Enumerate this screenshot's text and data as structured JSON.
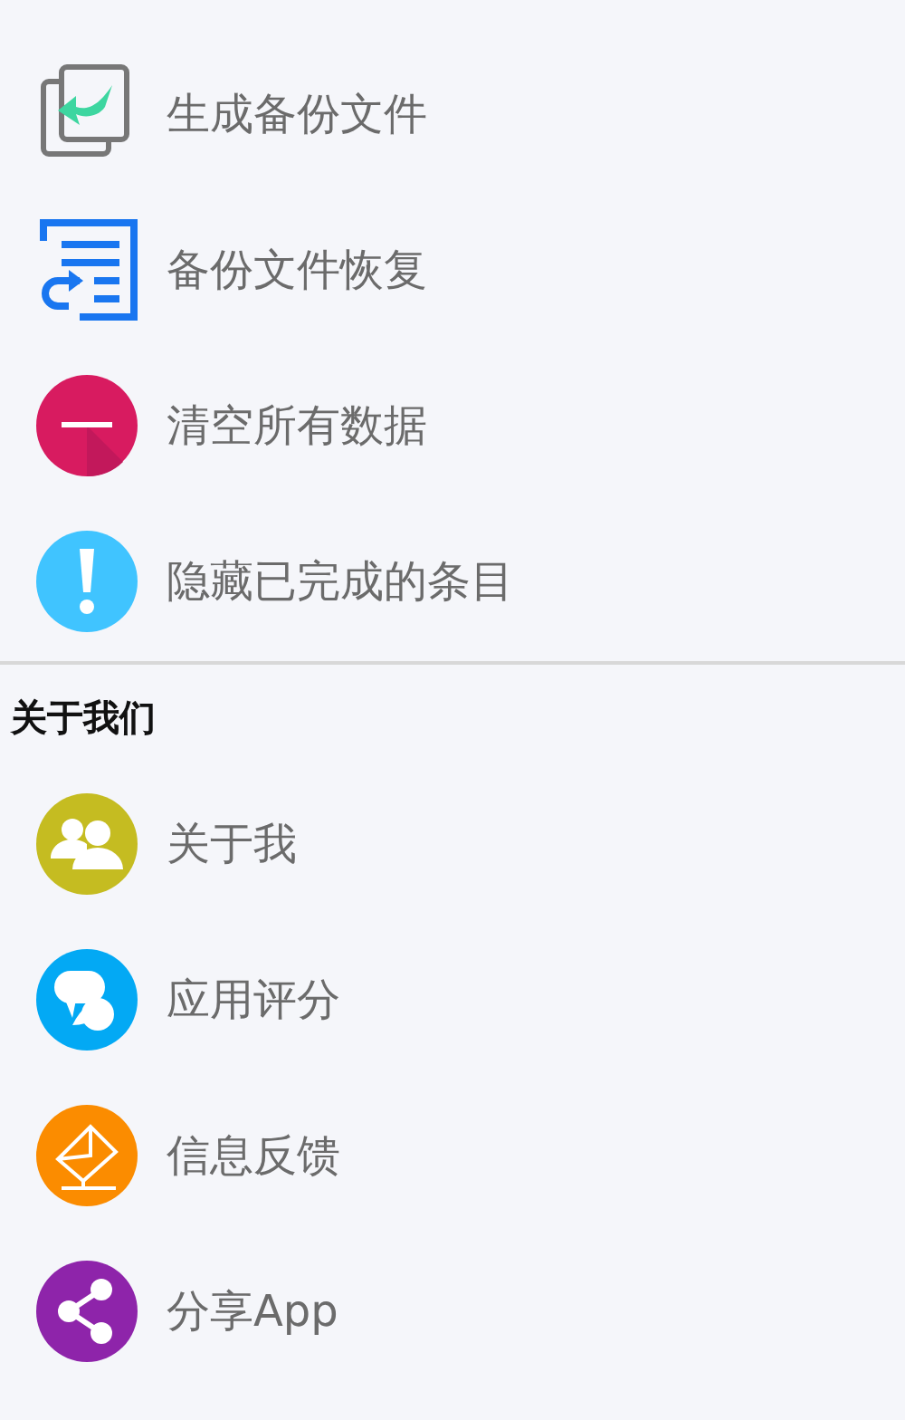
{
  "sections": [
    {
      "items": [
        {
          "kind": "backup",
          "label": "生成备份文件"
        },
        {
          "kind": "restore",
          "label": "备份文件恢复"
        },
        {
          "kind": "clear",
          "label": "清空所有数据"
        },
        {
          "kind": "hide",
          "label": "隐藏已完成的条目"
        }
      ]
    },
    {
      "title": "关于我们",
      "items": [
        {
          "kind": "about",
          "label": "关于我"
        },
        {
          "kind": "rate",
          "label": "应用评分"
        },
        {
          "kind": "feedback",
          "label": "信息反馈"
        },
        {
          "kind": "share",
          "label": "分享App"
        }
      ]
    }
  ]
}
